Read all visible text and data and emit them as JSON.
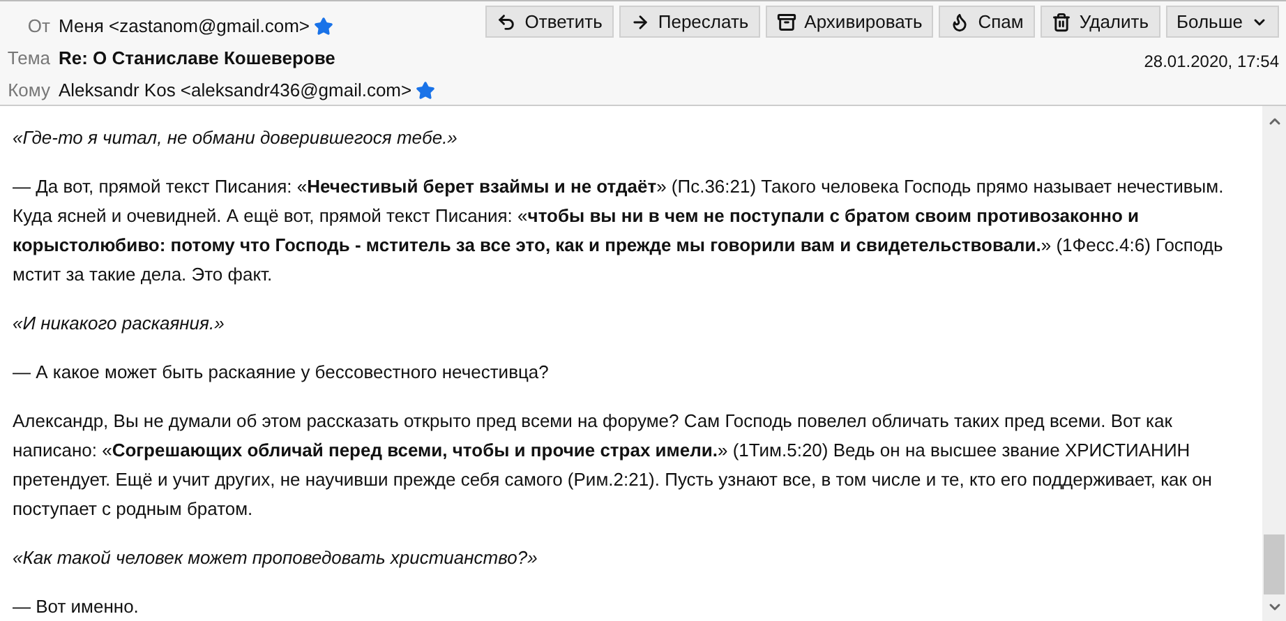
{
  "header": {
    "from": {
      "label": "От",
      "value": "Меня <zastanom@gmail.com>",
      "starred": true
    },
    "subject": {
      "label": "Тема",
      "value": "Re: О Станиславе Кошеверове"
    },
    "to": {
      "label": "Кому",
      "value": "Aleksandr Kos <aleksandr436@gmail.com>",
      "starred": true
    },
    "date": "28.01.2020, 17:54"
  },
  "toolbar": [
    {
      "kind": "reply",
      "label": "Ответить"
    },
    {
      "kind": "forward",
      "label": "Переслать"
    },
    {
      "kind": "archive",
      "label": "Архивировать"
    },
    {
      "kind": "spam",
      "label": "Спам"
    },
    {
      "kind": "delete",
      "label": "Удалить"
    },
    {
      "kind": "more",
      "label": "Больше"
    }
  ],
  "body": [
    {
      "kind": "quote",
      "text": "«Где-то я читал, не обмани доверившегося тебе.»"
    },
    {
      "kind": "text",
      "text": "— Да вот, прямой текст Писания: «**Нечестивый берет взаймы и не отдаёт**» (Пс.36:21) Такого человека Господь прямо называет нечестивым. Куда ясней и очевидней. А ещё вот, прямой текст Писания: «**чтобы вы ни в чем не поступали с братом своим противозаконно и корыстолюбиво: потому что Господь - мститель за все это, как и прежде мы говорили вам и свидетельствовали.**» (1Фесс.4:6) Господь мстит за такие дела. Это факт."
    },
    {
      "kind": "quote",
      "text": "«И никакого раскаяния.»"
    },
    {
      "kind": "text",
      "text": "— А какое может быть раскаяние у бессовестного нечестивца?"
    },
    {
      "kind": "text",
      "text": "Александр, Вы не думали об этом рассказать открыто пред всеми на форуме? Сам Господь повелел обличать таких пред всеми. Вот как написано: «**Согрешающих обличай перед всеми, чтобы и прочие страх имели.**» (1Тим.5:20) Ведь он на высшее звание ХРИСТИАНИН претендует. Ещё и учит других, не научивши прежде себя самого (Рим.2:21). Пусть узнают все, в том числе и те, кто его поддерживает, как он поступает с родным братом."
    },
    {
      "kind": "quote",
      "text": "«Как такой человек может проповедовать христианство?»"
    },
    {
      "kind": "text",
      "text": "— Вот именно."
    }
  ]
}
